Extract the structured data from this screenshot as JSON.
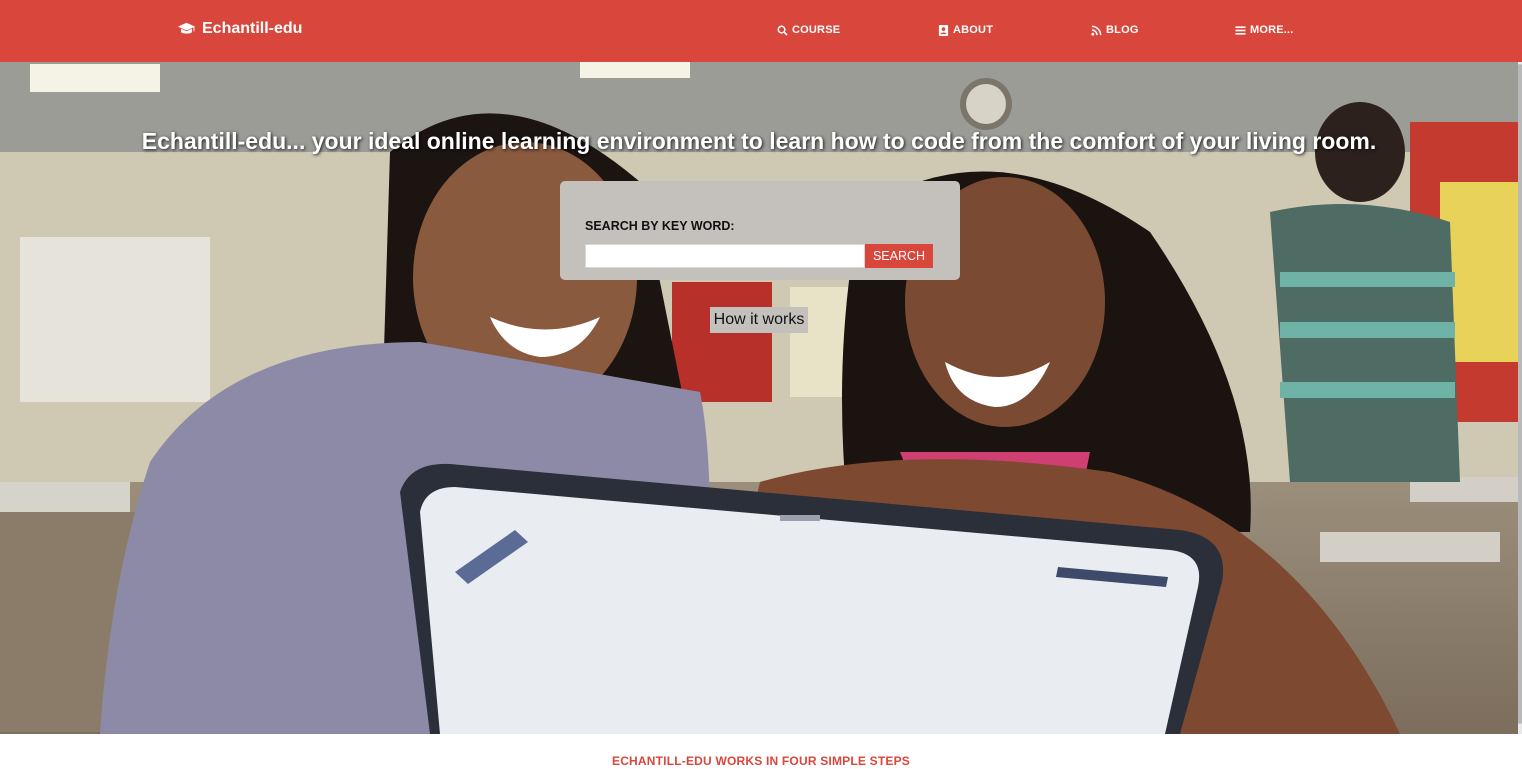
{
  "nav": {
    "brand": "Echantill-edu",
    "items": [
      {
        "label": "COURSE",
        "icon": "search-icon"
      },
      {
        "label": "ABOUT",
        "icon": "contact-card-icon"
      },
      {
        "label": "BLOG",
        "icon": "rss-icon"
      },
      {
        "label": "MORE...",
        "icon": "hamburger-menu-icon"
      }
    ]
  },
  "hero": {
    "headline": "Echantill-edu... your ideal online learning environment to learn how to code from the comfort of your living room.",
    "search": {
      "label": "SEARCH BY KEY WORD:",
      "input_value": "",
      "input_placeholder": "",
      "button_label": "SEARCH"
    },
    "how_it_works_label": "How it works"
  },
  "steps": {
    "title": "ECHANTILL-EDU WORKS IN FOUR SIMPLE STEPS"
  },
  "colors": {
    "accent": "#d9463b",
    "panel": "#c4c1bd",
    "text_on_accent": "#ffffff"
  }
}
